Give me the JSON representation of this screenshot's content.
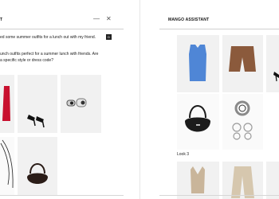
{
  "left_panel": {
    "title": "T",
    "minimize_icon": "—",
    "close_icon": "✕",
    "user_message": "ed some summer outfits for a lunch out with my friend.",
    "send_chip": "D",
    "assistant_message_lines": [
      "unch outfits perfect for a summer lunch with friends. Are",
      "a specific style or dress code?"
    ]
  },
  "right_panel": {
    "title": "MANGO ASSISTANT",
    "look_label": "Look 3"
  },
  "colors": {
    "tile_bg": "#f1f1f1",
    "red_dress": "#c8102e",
    "blue_top": "#4f86d6",
    "brown_shorts": "#8b5a3c",
    "bag_dark": "#1c1c1c",
    "linen": "#c9b59a"
  }
}
